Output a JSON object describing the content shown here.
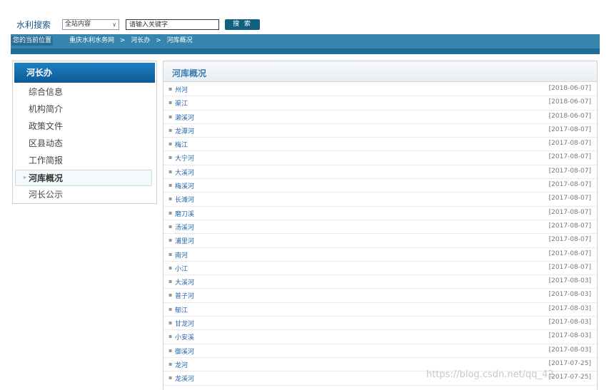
{
  "search": {
    "label": "水利搜索",
    "scope_value": "全站内容",
    "placeholder": "请输入关键字",
    "button_label": "搜 索"
  },
  "breadcrumb": {
    "here_label": "您的当前位置",
    "items": [
      "重庆水利水务网",
      ">",
      "河长办",
      ">",
      "河库概况"
    ]
  },
  "sidebar": {
    "title": "河长办",
    "items": [
      {
        "label": "综合信息"
      },
      {
        "label": "机构简介"
      },
      {
        "label": "政策文件"
      },
      {
        "label": "区县动态"
      },
      {
        "label": "工作简报"
      },
      {
        "label": "河库概况",
        "active": true
      },
      {
        "label": "河长公示"
      }
    ]
  },
  "panel": {
    "title": "河库概况",
    "rows": [
      {
        "title": "州河",
        "date": "[2018-06-07]"
      },
      {
        "title": "渠江",
        "date": "[2018-06-07]"
      },
      {
        "title": "濑溪河",
        "date": "[2018-06-07]"
      },
      {
        "title": "龙潭河",
        "date": "[2017-08-07]"
      },
      {
        "title": "梅江",
        "date": "[2017-08-07]"
      },
      {
        "title": "大宁河",
        "date": "[2017-08-07]"
      },
      {
        "title": "大溪河",
        "date": "[2017-08-07]"
      },
      {
        "title": "梅溪河",
        "date": "[2017-08-07]"
      },
      {
        "title": "长滩河",
        "date": "[2017-08-07]"
      },
      {
        "title": "磨刀溪",
        "date": "[2017-08-07]"
      },
      {
        "title": "汤溪河",
        "date": "[2017-08-07]"
      },
      {
        "title": "浦里河",
        "date": "[2017-08-07]"
      },
      {
        "title": "南河",
        "date": "[2017-08-07]"
      },
      {
        "title": "小江",
        "date": "[2017-08-07]"
      },
      {
        "title": "大溪河",
        "date": "[2017-08-03]"
      },
      {
        "title": "普子河",
        "date": "[2017-08-03]"
      },
      {
        "title": "郁江",
        "date": "[2017-08-03]"
      },
      {
        "title": "甘龙河",
        "date": "[2017-08-03]"
      },
      {
        "title": "小安溪",
        "date": "[2017-08-03]"
      },
      {
        "title": "御溪河",
        "date": "[2017-08-03]"
      },
      {
        "title": "龙河",
        "date": "[2017-07-25]"
      },
      {
        "title": "龙溪河",
        "date": "[2017-07-25]"
      }
    ]
  },
  "watermark": "https://blog.csdn.net/qq_42"
}
